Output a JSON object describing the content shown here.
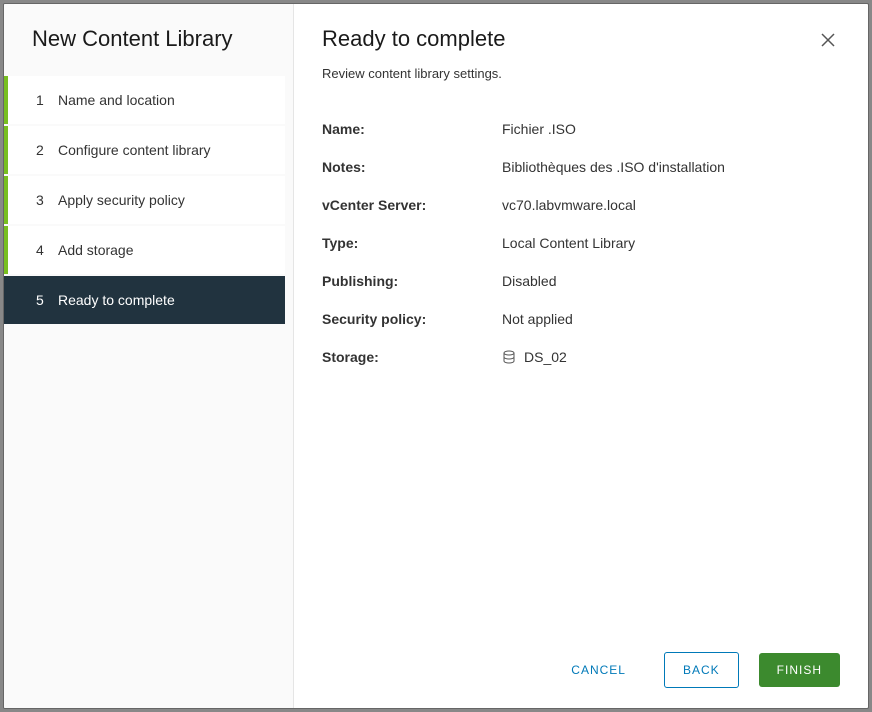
{
  "sidebar": {
    "title": "New Content Library",
    "steps": [
      {
        "num": "1",
        "label": "Name and location"
      },
      {
        "num": "2",
        "label": "Configure content library"
      },
      {
        "num": "3",
        "label": "Apply security policy"
      },
      {
        "num": "4",
        "label": "Add storage"
      },
      {
        "num": "5",
        "label": "Ready to complete"
      }
    ]
  },
  "main": {
    "title": "Ready to complete",
    "subtitle": "Review content library settings.",
    "rows": {
      "name": {
        "label": "Name:",
        "value": "Fichier .ISO"
      },
      "notes": {
        "label": "Notes:",
        "value": "Bibliothèques des .ISO d'installation"
      },
      "vcenter": {
        "label": "vCenter Server:",
        "value": "vc70.labvmware.local"
      },
      "type": {
        "label": "Type:",
        "value": "Local Content Library"
      },
      "publishing": {
        "label": "Publishing:",
        "value": "Disabled"
      },
      "security": {
        "label": "Security policy:",
        "value": "Not applied"
      },
      "storage": {
        "label": "Storage:",
        "value": "DS_02"
      }
    }
  },
  "footer": {
    "cancel": "CANCEL",
    "back": "BACK",
    "finish": "FINISH"
  }
}
